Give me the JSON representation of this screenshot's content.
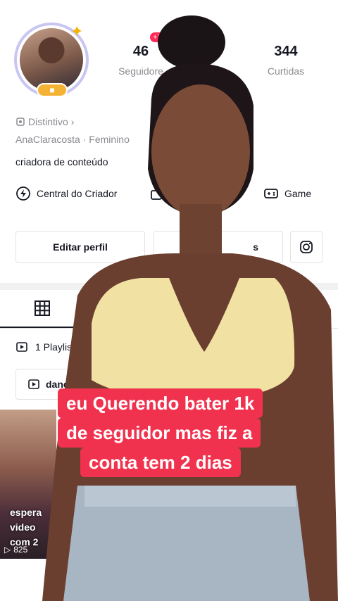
{
  "profile": {
    "following_count": "46",
    "new_badge": "+15",
    "following_label": "Seguidore",
    "likes_count": "344",
    "likes_label": "Curtidas",
    "distintivo_label": "Distintivo",
    "username": "AnaClaracosta",
    "gender": "Feminino",
    "bio": "criadora de conteúdo"
  },
  "tools": {
    "creator_center": "Central do Criador",
    "game": "Game"
  },
  "buttons": {
    "edit_profile": "Editar perfil",
    "second_partial": "s"
  },
  "content": {
    "playlist_label": "1 Playlist",
    "chip_label": "dancin",
    "thumb_text": [
      "espera",
      "video",
      "com 2"
    ],
    "thumb_views": "825"
  },
  "caption": {
    "lines": [
      "eu Querendo bater 1k",
      "de seguidor mas fiz a",
      "conta tem 2 dias"
    ]
  },
  "colors": {
    "caption_bg": "#f0324e",
    "badge_red": "#fe2c55",
    "text_primary": "#161823",
    "text_secondary": "#8a8b91"
  }
}
